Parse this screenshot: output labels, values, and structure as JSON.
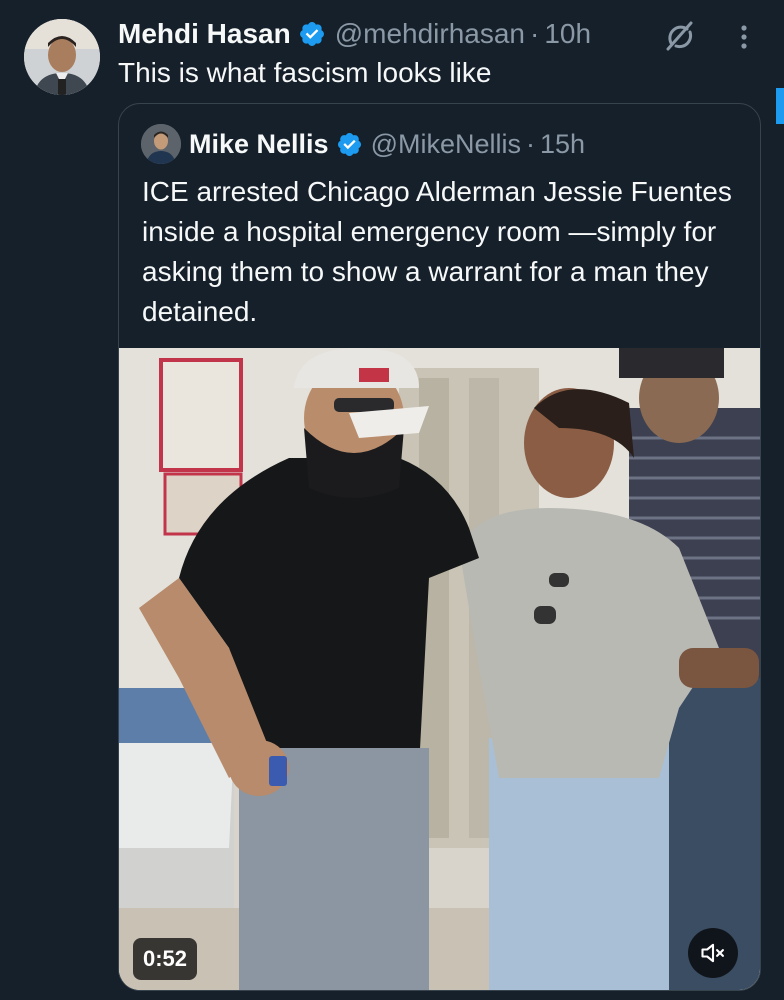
{
  "tweet": {
    "author_name": "Mehdi Hasan",
    "handle": "@mehdirhasan",
    "separator": "·",
    "time": "10h",
    "text": "This is what fascism looks like",
    "avatar_icon": "user-avatar-photo",
    "verified_icon": "verified-badge-icon",
    "grok_icon": "grok-icon",
    "more_icon": "more-options-icon"
  },
  "quoted_tweet": {
    "author_name": "Mike Nellis",
    "handle": "@MikeNellis",
    "separator": "·",
    "time": "15h",
    "text": "ICE arrested Chicago Alderman Jessie Fuentes inside a hospital emergency room —simply for asking them to show a warrant for a man they detained.",
    "video": {
      "duration": "0:52",
      "mute_icon": "muted-speaker-icon"
    }
  },
  "colors": {
    "background": "#15202b",
    "text_primary": "#f7f9f9",
    "text_secondary": "#8b98a5",
    "verified": "#1d9bf0",
    "border": "#38444d"
  }
}
